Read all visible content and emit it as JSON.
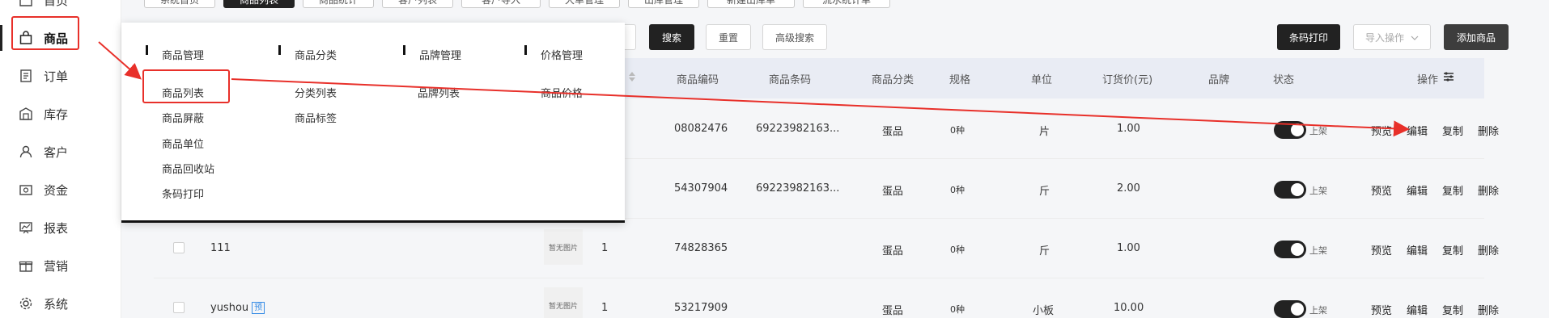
{
  "tabs": [
    "系统首页",
    "商品列表",
    "商品统计",
    "客户列表",
    "客户导入",
    "大单管理",
    "出库管理",
    "新建出库单",
    "流水统计单"
  ],
  "sidebar": {
    "items": [
      {
        "label": "首页",
        "icon": "home-icon"
      },
      {
        "label": "商品",
        "icon": "shopping-bag-icon"
      },
      {
        "label": "订单",
        "icon": "order-icon"
      },
      {
        "label": "库存",
        "icon": "warehouse-icon"
      },
      {
        "label": "客户",
        "icon": "user-icon"
      },
      {
        "label": "资金",
        "icon": "wallet-icon"
      },
      {
        "label": "报表",
        "icon": "chart-icon"
      },
      {
        "label": "营销",
        "icon": "gift-icon"
      },
      {
        "label": "系统",
        "icon": "gear-icon"
      }
    ]
  },
  "toolbar": {
    "search": "搜索",
    "reset": "重置",
    "advanced": "高级搜索",
    "barcode_print": "条码打印",
    "import_ops": "导入操作",
    "add_product": "添加商品"
  },
  "mega_menu": {
    "columns": [
      {
        "title": "商品管理",
        "items": [
          "商品列表",
          "商品屏蔽",
          "商品单位",
          "商品回收站",
          "条码打印"
        ]
      },
      {
        "title": "商品分类",
        "items": [
          "分类列表",
          "商品标签"
        ]
      },
      {
        "title": "品牌管理",
        "items": [
          "品牌列表"
        ]
      },
      {
        "title": "价格管理",
        "items": [
          "商品价格"
        ]
      }
    ]
  },
  "table": {
    "headers": [
      "商品编码",
      "商品条码",
      "商品分类",
      "规格",
      "单位",
      "订货价(元)",
      "品牌",
      "状态",
      "操作"
    ],
    "rows": [
      {
        "name": "",
        "img": "",
        "qty": "",
        "code": "08082476",
        "barcode": "69223982163...",
        "category": "蛋品",
        "spec": "0种",
        "unit": "片",
        "price": "1.00",
        "status": "上架"
      },
      {
        "name": "",
        "img": "",
        "qty": "",
        "code": "54307904",
        "barcode": "69223982163...",
        "category": "蛋品",
        "spec": "0种",
        "unit": "斤",
        "price": "2.00",
        "status": "上架"
      },
      {
        "name": "111",
        "img": "暂无图片",
        "qty": "1",
        "code": "74828365",
        "barcode": "",
        "category": "蛋品",
        "spec": "0种",
        "unit": "斤",
        "price": "1.00",
        "status": "上架"
      },
      {
        "name": "yushou",
        "tag": "预",
        "img": "暂无图片",
        "qty": "1",
        "code": "53217909",
        "barcode": "",
        "category": "蛋品",
        "spec": "0种",
        "unit": "小板",
        "price": "10.00",
        "status": "上架"
      }
    ],
    "ops": [
      "预览",
      "编辑",
      "复制",
      "删除"
    ]
  }
}
